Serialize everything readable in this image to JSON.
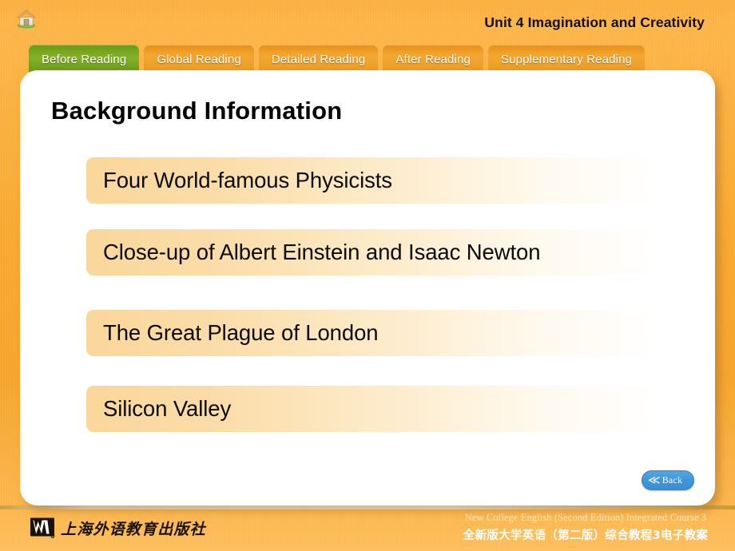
{
  "header": {
    "home_icon": "home-icon",
    "unit_title": "Unit 4 Imagination and Creativity"
  },
  "tabs": [
    {
      "label": "Before Reading",
      "active": true,
      "color": "#7aa61f"
    },
    {
      "label": "Global Reading",
      "active": false,
      "color": "#ef9f23"
    },
    {
      "label": "Detailed Reading",
      "active": false,
      "color": "#ef9f23"
    },
    {
      "label": "After Reading",
      "active": false,
      "color": "#ef9f23"
    },
    {
      "label": "Supplementary Reading",
      "active": false,
      "color": "#ef9f23"
    }
  ],
  "main": {
    "page_title": "Background Information",
    "topics": [
      {
        "label": "Four World-famous Physicists"
      },
      {
        "label": "Close-up of Albert Einstein and Isaac Newton"
      },
      {
        "label": "The Great Plague of London"
      },
      {
        "label": "Silicon Valley"
      }
    ],
    "back_button": {
      "label": "Back",
      "icon": "double-chevron-left-icon",
      "color": "#3f95d6"
    }
  },
  "footer": {
    "publisher_mark": "w-emblem-icon",
    "publisher_name": "上海外语教育出版社",
    "course_en": "New College English (Second Edition) Integrated Course 3",
    "course_cn": "全新版大学英语（第二版）综合教程3电子教案"
  },
  "theme": {
    "background": "#f8a830",
    "panel": "#ffffff",
    "active_tab": "#7aa61f",
    "inactive_tab": "#ef9f23",
    "bar_start": "#fad79b",
    "accent_blue": "#3f95d6"
  }
}
